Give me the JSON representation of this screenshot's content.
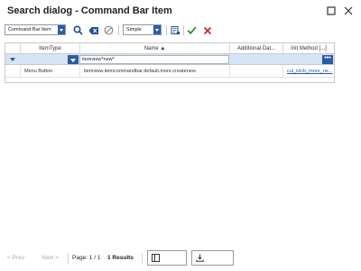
{
  "window": {
    "title": "Search dialog - Command Bar Item"
  },
  "toolbar": {
    "type_select": "Command Bar Item",
    "mode_select": "Simple"
  },
  "grid": {
    "columns": [
      {
        "label": "ItemType"
      },
      {
        "label": "Name ▲"
      },
      {
        "label": "Additional Dat..."
      },
      {
        "label": "Init Method [...]"
      }
    ],
    "filter": {
      "name_value": "itemview*new*",
      "more_label": "•••"
    },
    "rows": [
      {
        "item_type": "Menu Button",
        "name": "itemview.itemcommandbar.default.more.createnew",
        "additional_data": "",
        "init_method": "cui_ivicb_more_ne..."
      }
    ]
  },
  "footer": {
    "prev_label": "< Prev",
    "next_label": "Next >",
    "page_label": "Page: 1 / 1",
    "results_label": "1 Results"
  },
  "colors": {
    "accent": "#2a5ea3",
    "filter_row": "#d6e4f7",
    "confirm": "#2e8b3a",
    "cancel": "#c62828"
  }
}
